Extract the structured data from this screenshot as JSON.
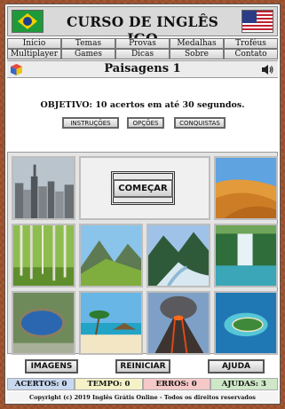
{
  "header": {
    "title": "CURSO DE INGLÊS IGO",
    "left_flag": "brazil-flag",
    "right_flag": "usa-flag"
  },
  "menu": {
    "items": [
      "Início",
      "Temas",
      "Provas",
      "Medalhas",
      "Troféus",
      "Multiplayer",
      "Games",
      "Dicas",
      "Sobre",
      "Contato"
    ]
  },
  "level": {
    "title": "Paisagens 1",
    "left_icon": "cube-icon",
    "right_icon": "speaker-icon"
  },
  "objective": {
    "text": "OBJETIVO: 10 acertos em até 30 segundos.",
    "buttons": [
      "INSTRUÇÕES",
      "OPÇÕES",
      "CONQUISTAS"
    ]
  },
  "start_button": "COMEÇAR",
  "images": [
    "city-skyline",
    "desert-dunes",
    "birch-forest",
    "green-mountains",
    "mountain-river",
    "waterfall",
    "crater-lake",
    "tropical-beach",
    "volcano",
    "island-atoll"
  ],
  "bottom_buttons": [
    "IMAGENS",
    "REINICIAR",
    "AJUDA"
  ],
  "status": {
    "acertos": "ACERTOS: 0",
    "tempo": "TEMPO: 0",
    "erros": "ERROS: 0",
    "ajudas": "AJUDAS: 3",
    "colors": {
      "acertos": "#c8d8f0",
      "tempo": "#f5f2c8",
      "erros": "#f6c9c9",
      "ajudas": "#cfe8c8"
    }
  },
  "footer": "Copyright (c) 2019 Inglês Grátis Online - Todos os direitos reservados"
}
